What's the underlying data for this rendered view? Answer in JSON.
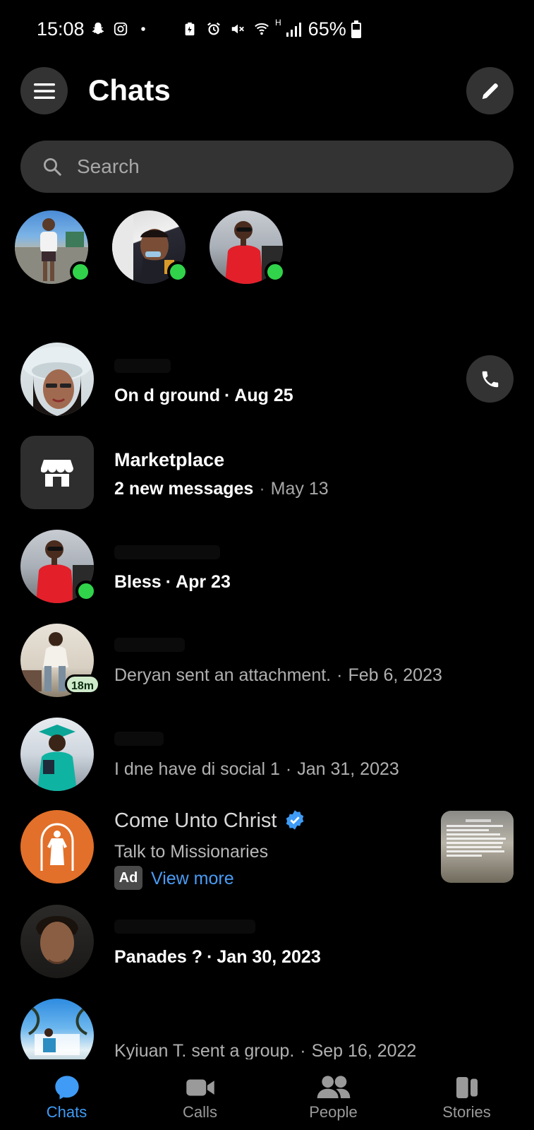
{
  "status_bar": {
    "time": "15:08",
    "network": "H",
    "battery": "65%"
  },
  "header": {
    "title": "Chats"
  },
  "search": {
    "placeholder": "Search"
  },
  "active_friends": [
    {
      "online": true
    },
    {
      "online": true
    },
    {
      "online": true
    }
  ],
  "chats": [
    {
      "message": "On d ground",
      "date": "Aug 25",
      "unread": true
    },
    {
      "name": "Marketplace",
      "message": "2 new messages",
      "date": "May 13",
      "unread": true
    },
    {
      "message": "Bless",
      "date": "Apr 23",
      "unread": true,
      "online": true
    },
    {
      "message": "Deryan sent an attachment.",
      "date": "Feb 6, 2023",
      "badge": "18m"
    },
    {
      "message": "I dne have di social 1",
      "date": "Jan 31, 2023"
    },
    {
      "name": "Panades ?",
      "date": "Jan 30, 2023",
      "unread": true
    },
    {
      "message": "Kyiuan T. sent a group.",
      "date": "Sep 16, 2022"
    }
  ],
  "ad": {
    "name": "Come Unto Christ",
    "subtitle": "Talk to Missionaries",
    "badge": "Ad",
    "link": "View more"
  },
  "sep": "·",
  "colors": {
    "accent": "#3f9bf5",
    "online": "#31d34b",
    "ad_orange": "#e2702a",
    "link": "#4a9cf5"
  },
  "bottom_nav": [
    {
      "label": "Chats",
      "icon": "chat-bubble-icon",
      "active": true
    },
    {
      "label": "Calls",
      "icon": "video-camera-icon"
    },
    {
      "label": "People",
      "icon": "people-icon"
    },
    {
      "label": "Stories",
      "icon": "stories-icon"
    }
  ]
}
